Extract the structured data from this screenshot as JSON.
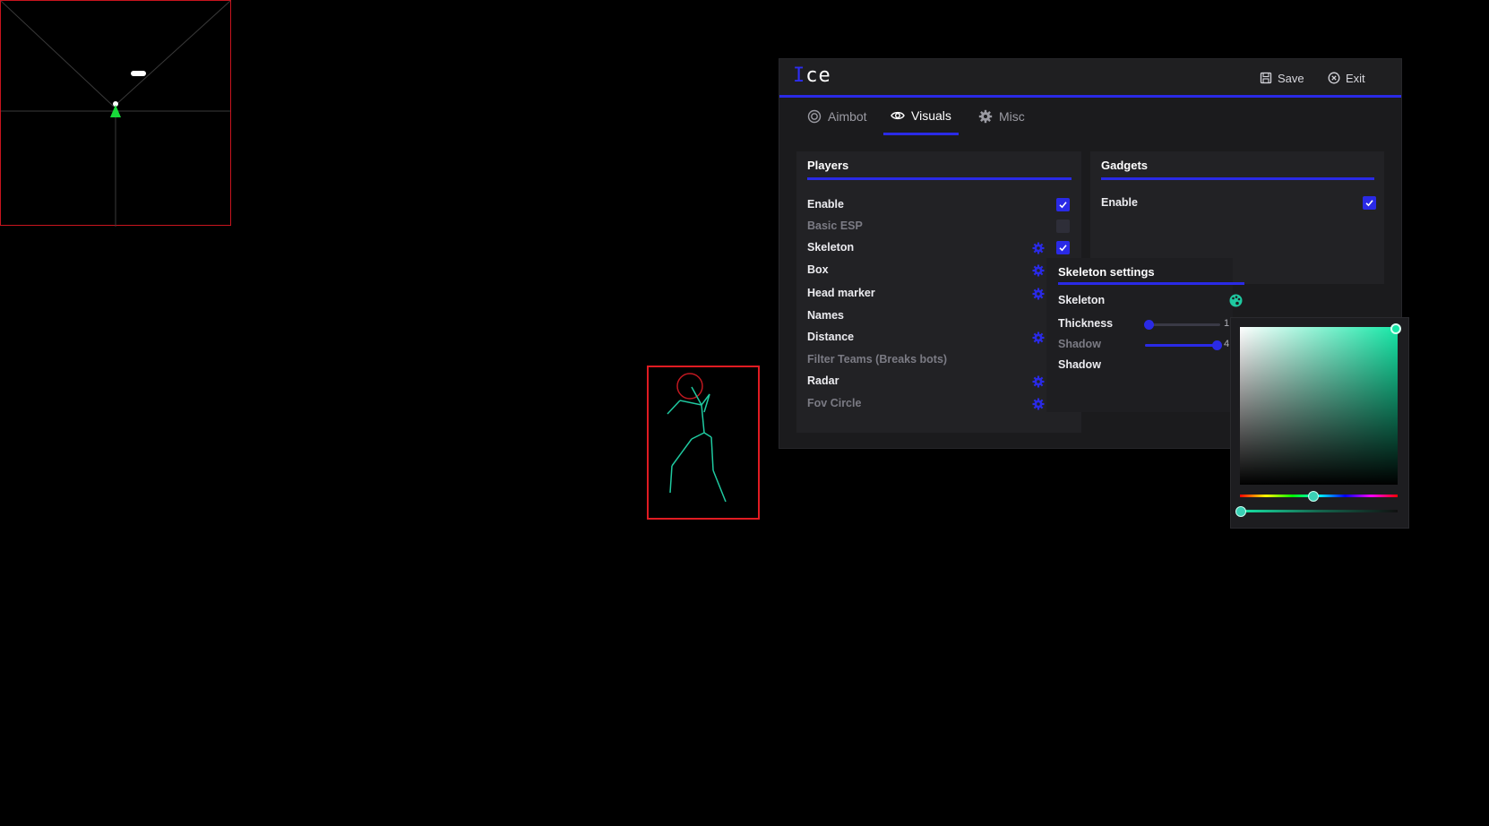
{
  "app": {
    "logo_prefix": "I",
    "logo_rest": "ce",
    "save_label": "Save",
    "exit_label": "Exit"
  },
  "tabs": [
    {
      "label": "Aimbot",
      "icon": "target-icon",
      "active": false
    },
    {
      "label": "Visuals",
      "icon": "eye-icon",
      "active": true
    },
    {
      "label": "Misc",
      "icon": "gear-icon",
      "active": false
    }
  ],
  "players": {
    "title": "Players",
    "rows": [
      {
        "label": "Enable",
        "checked": true,
        "enabled": true,
        "has_settings": false,
        "has_checkbox": true
      },
      {
        "label": "Basic ESP",
        "checked": false,
        "enabled": false,
        "has_settings": false,
        "has_checkbox": true
      },
      {
        "label": "Skeleton",
        "checked": true,
        "enabled": true,
        "has_settings": true,
        "has_checkbox": true
      },
      {
        "label": "Box",
        "checked": false,
        "enabled": true,
        "has_settings": true,
        "has_checkbox": false
      },
      {
        "label": "Head marker",
        "checked": false,
        "enabled": true,
        "has_settings": true,
        "has_checkbox": false
      },
      {
        "label": "Names",
        "checked": false,
        "enabled": true,
        "has_settings": false,
        "has_checkbox": false
      },
      {
        "label": "Distance",
        "checked": false,
        "enabled": true,
        "has_settings": true,
        "has_checkbox": false
      },
      {
        "label": "Filter Teams (Breaks bots)",
        "checked": false,
        "enabled": false,
        "has_settings": false,
        "has_checkbox": false
      },
      {
        "label": "Radar",
        "checked": false,
        "enabled": true,
        "has_settings": true,
        "has_checkbox": false
      },
      {
        "label": "Fov Circle",
        "checked": false,
        "enabled": false,
        "has_settings": true,
        "has_checkbox": true
      }
    ]
  },
  "gadgets": {
    "title": "Gadgets",
    "rows": [
      {
        "label": "Enable",
        "checked": true
      }
    ]
  },
  "skeleton_settings": {
    "title": "Skeleton settings",
    "skeleton_label": "Skeleton",
    "thickness_label": "Thickness",
    "thickness_value": "1",
    "thickness_fraction": 0.05,
    "shadow_label": "Shadow",
    "shadow_value": "4",
    "shadow_fraction": 0.95,
    "shadow_toggle_label": "Shadow"
  },
  "color_picker": {
    "color": "#17e8a8",
    "hue_fraction": 0.46,
    "alpha_fraction": 0.0
  },
  "colors": {
    "accent": "#2a2ae6",
    "esp_box": "#e01b22",
    "skeleton": "#1fc9a0"
  }
}
